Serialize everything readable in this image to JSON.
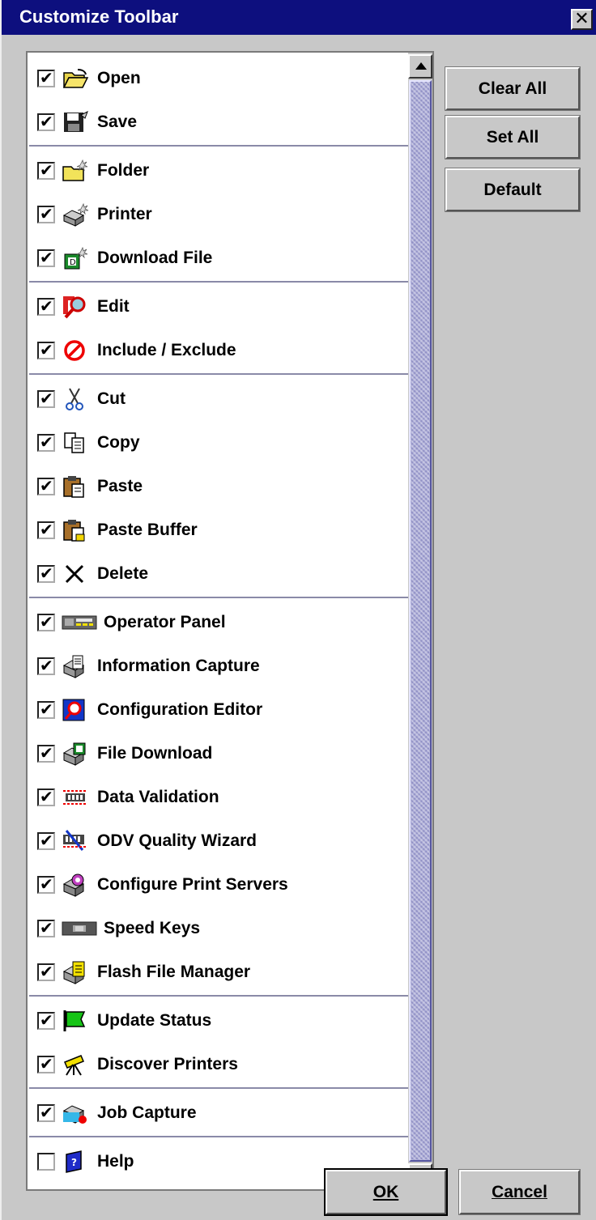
{
  "window": {
    "title": "Customize Toolbar",
    "close_label": "✕"
  },
  "buttons": {
    "clear_all": "Clear All",
    "set_all": "Set All",
    "default": "Default",
    "ok": "OK",
    "cancel": "Cancel"
  },
  "groups": [
    {
      "items": [
        {
          "label": "Open",
          "checked": true,
          "icon": "open-folder-icon"
        },
        {
          "label": "Save",
          "checked": true,
          "icon": "save-icon"
        }
      ]
    },
    {
      "items": [
        {
          "label": "Folder",
          "checked": true,
          "icon": "new-folder-icon"
        },
        {
          "label": "Printer",
          "checked": true,
          "icon": "new-printer-icon"
        },
        {
          "label": "Download File",
          "checked": true,
          "icon": "download-file-icon"
        }
      ]
    },
    {
      "items": [
        {
          "label": "Edit",
          "checked": true,
          "icon": "edit-magnifier-icon"
        },
        {
          "label": "Include / Exclude",
          "checked": true,
          "icon": "prohibited-icon"
        }
      ]
    },
    {
      "items": [
        {
          "label": "Cut",
          "checked": true,
          "icon": "scissors-icon"
        },
        {
          "label": "Copy",
          "checked": true,
          "icon": "copy-icon"
        },
        {
          "label": "Paste",
          "checked": true,
          "icon": "paste-icon"
        },
        {
          "label": "Paste Buffer",
          "checked": true,
          "icon": "paste-buffer-icon"
        },
        {
          "label": "Delete",
          "checked": true,
          "icon": "delete-x-icon"
        }
      ]
    },
    {
      "items": [
        {
          "label": "Operator Panel",
          "checked": true,
          "icon": "operator-panel-icon"
        },
        {
          "label": "Information Capture",
          "checked": true,
          "icon": "information-capture-icon"
        },
        {
          "label": "Configuration Editor",
          "checked": true,
          "icon": "configuration-editor-icon"
        },
        {
          "label": "File Download",
          "checked": true,
          "icon": "file-download-icon"
        },
        {
          "label": "Data Validation",
          "checked": true,
          "icon": "data-validation-icon"
        },
        {
          "label": "ODV Quality Wizard",
          "checked": true,
          "icon": "odv-wizard-icon"
        },
        {
          "label": "Configure Print Servers",
          "checked": true,
          "icon": "print-servers-icon"
        },
        {
          "label": "Speed Keys",
          "checked": true,
          "icon": "speed-keys-icon"
        },
        {
          "label": "Flash File Manager",
          "checked": true,
          "icon": "flash-file-manager-icon"
        }
      ]
    },
    {
      "items": [
        {
          "label": "Update Status",
          "checked": true,
          "icon": "green-flag-icon"
        },
        {
          "label": "Discover Printers",
          "checked": true,
          "icon": "telescope-icon"
        }
      ]
    },
    {
      "items": [
        {
          "label": "Job Capture",
          "checked": true,
          "icon": "job-capture-icon"
        }
      ]
    },
    {
      "items": [
        {
          "label": "Help",
          "checked": false,
          "icon": "help-book-icon"
        }
      ]
    }
  ]
}
